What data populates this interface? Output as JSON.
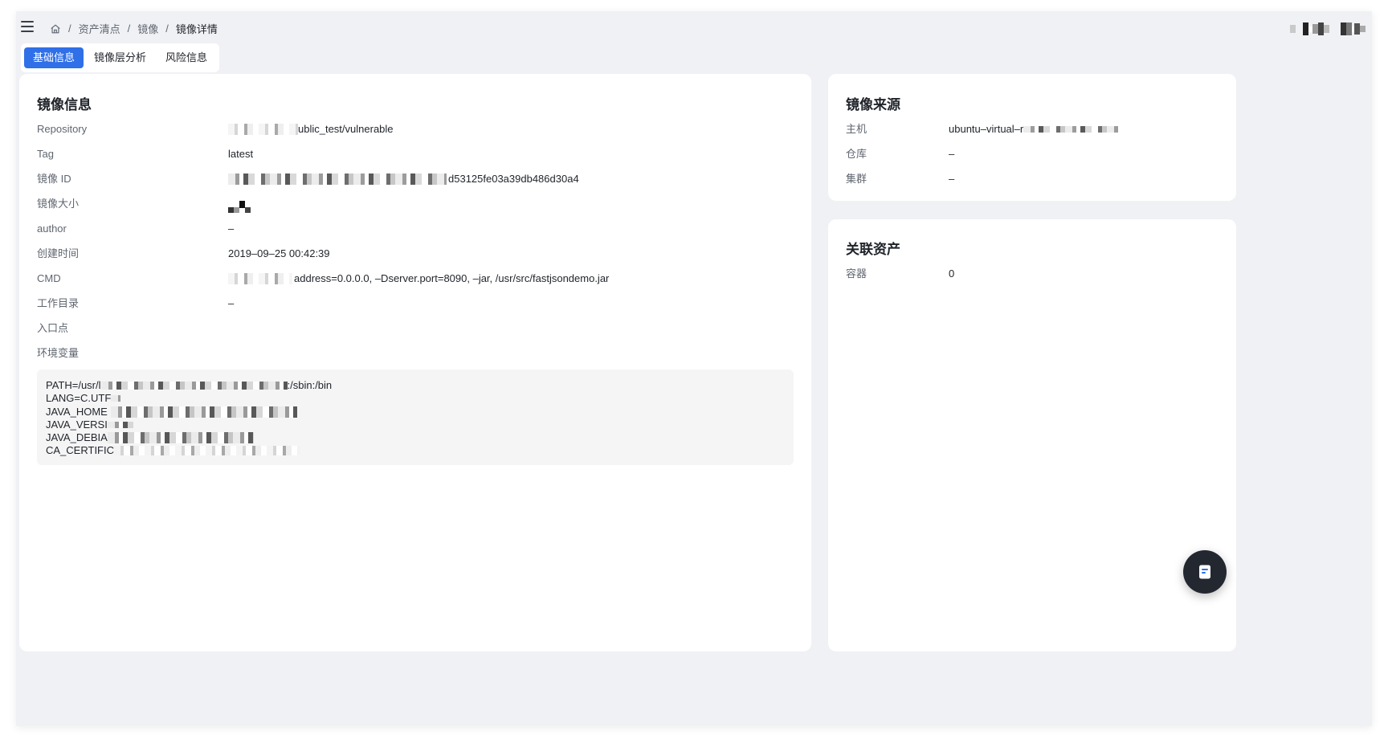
{
  "breadcrumb": {
    "home_icon": "home-icon",
    "items": [
      "资产清点",
      "镜像",
      "镜像详情"
    ],
    "separator": "/"
  },
  "tabs": [
    "基础信息",
    "镜像层分析",
    "风险信息"
  ],
  "image_info": {
    "title": "镜像信息",
    "fields": [
      {
        "key": "Repository",
        "value": "ublic_test/vulnerable"
      },
      {
        "key": "Tag",
        "value": "latest"
      },
      {
        "key": "镜像 ID",
        "value": "d53125fe03a39db486d30a4"
      },
      {
        "key": "镜像大小",
        "value": ""
      },
      {
        "key": "author",
        "value": "–"
      },
      {
        "key": "创建时间",
        "value": "2019–09–25 00:42:39"
      },
      {
        "key": "CMD",
        "value": "address=0.0.0.0, –Dserver.port=8090, –jar, /usr/src/fastjsondemo.jar"
      },
      {
        "key": "工作目录",
        "value": "–"
      },
      {
        "key": "入口点",
        "value": ""
      },
      {
        "key": "环境变量",
        "value": ""
      }
    ],
    "env_lines": [
      {
        "prefix": "PATH=/usr/l",
        "suffix": ":/sbin:/bin"
      },
      {
        "prefix": "LANG=C.UTF",
        "suffix": ""
      },
      {
        "prefix": "JAVA_HOME",
        "suffix": ""
      },
      {
        "prefix": "JAVA_VERSI",
        "suffix": ""
      },
      {
        "prefix": "JAVA_DEBIA",
        "suffix": ""
      },
      {
        "prefix": "CA_CERTIFIC",
        "suffix": ""
      }
    ]
  },
  "image_source": {
    "title": "镜像来源",
    "fields": [
      {
        "key": "主机",
        "value": "ubuntu–virtual–r"
      },
      {
        "key": "仓库",
        "value": "–"
      },
      {
        "key": "集群",
        "value": "–"
      }
    ]
  },
  "related_assets": {
    "title": "关联资产",
    "fields": [
      {
        "key": "容器",
        "value": "0"
      }
    ]
  },
  "colors": {
    "accent": "#2f6fe8",
    "page_bg": "#f0f1f5",
    "fab_bg": "#232730"
  }
}
